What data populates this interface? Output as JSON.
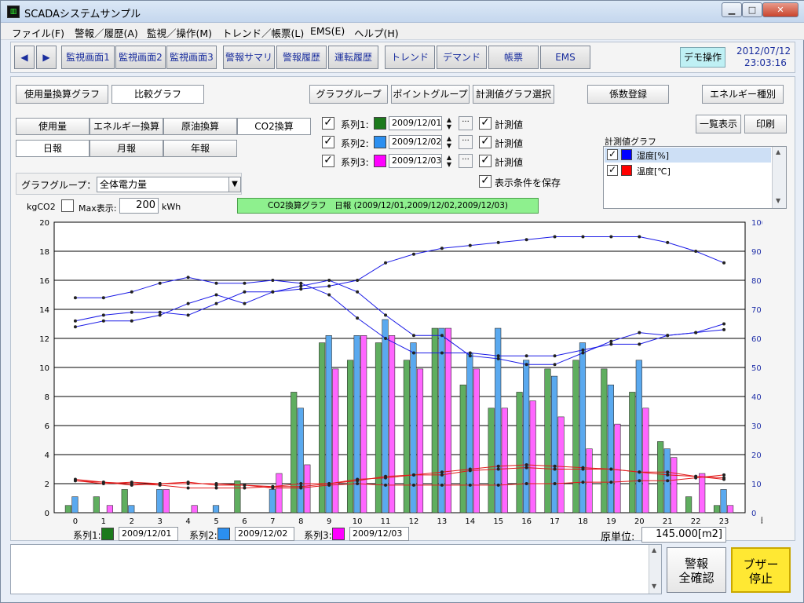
{
  "window": {
    "title": "SCADAシステムサンプル",
    "icon_name": "scada-app-icon",
    "controls": [
      "minimize-icon",
      "maximize-icon",
      "close-icon"
    ]
  },
  "menu": [
    "ファイル(F)",
    "警報／履歴(A)",
    "監視／操作(M)",
    "トレンド／帳票(L)",
    "EMS(E)",
    "ヘルプ(H)"
  ],
  "toolbar": {
    "prev_icon": "◀",
    "next_icon": "▶",
    "buttons": [
      "監視画面1",
      "監視画面2",
      "監視画面3",
      "警報サマリ",
      "警報履歴",
      "運転履歴",
      "トレンド",
      "デマンド",
      "帳票",
      "EMS"
    ],
    "demo": "デモ操作",
    "date": "2012/07/12",
    "time": "23:03:16"
  },
  "tabs_top": {
    "a": "使用量換算グラフ",
    "b": "比較グラフ"
  },
  "actions": {
    "graph_group": "グラフグループ",
    "point_group": "ポイントグループ",
    "meas_select": "計測値グラフ選択",
    "coef": "係数登録",
    "energy": "エネルギー種別"
  },
  "mode_tabs": [
    "使用量",
    "エネルギー換算",
    "原油換算",
    "CO2換算"
  ],
  "period_tabs": [
    "日報",
    "月報",
    "年報"
  ],
  "series_rows": [
    {
      "label": "系列1:",
      "color": "#1c7a1c",
      "date": "2009/12/01",
      "meas": "計測値"
    },
    {
      "label": "系列2:",
      "color": "#2b8ff0",
      "date": "2009/12/02",
      "meas": "計測値"
    },
    {
      "label": "系列3:",
      "color": "#ff00ff",
      "date": "2009/12/03",
      "meas": "計測値"
    }
  ],
  "save_cond": "表示条件を保存",
  "list_btn": "一覧表示",
  "print_btn": "印刷",
  "meas_graph": {
    "title": "計測値グラフ",
    "items": [
      {
        "label": "湿度[%]",
        "color": "#0000ff"
      },
      {
        "label": "温度[℃]",
        "color": "#ff0000"
      }
    ]
  },
  "graph_group": {
    "label": "グラフグループ：",
    "value": "全体電力量"
  },
  "unit_left": "kgCO2",
  "max_label": "Max表示:",
  "max_value": "200",
  "max_unit": "kWh",
  "chart_title": "CO2換算グラフ　日報 (2009/12/01,2009/12/02,2009/12/03)",
  "legend_bottom": [
    {
      "label": "系列1:",
      "date": "2009/12/01"
    },
    {
      "label": "系列2:",
      "date": "2009/12/02"
    },
    {
      "label": "系列3:",
      "date": "2009/12/03"
    }
  ],
  "unit_price": {
    "label": "原単位:",
    "value": "145.000[m2]"
  },
  "bottom_btns": {
    "ack": "警報\n全確認",
    "buzzer": "ブザー\n停止"
  },
  "chart_data": {
    "type": "bar",
    "x": [
      0,
      1,
      2,
      3,
      4,
      5,
      6,
      7,
      8,
      9,
      10,
      11,
      12,
      13,
      14,
      15,
      16,
      17,
      18,
      19,
      20,
      21,
      22,
      23
    ],
    "xlabel": "時",
    "ylim": [
      0,
      20
    ],
    "y2lim": [
      0,
      100
    ],
    "yticks": [
      0,
      2,
      4,
      6,
      8,
      10,
      12,
      14,
      16,
      18,
      20
    ],
    "y2ticks": [
      0,
      10,
      20,
      30,
      40,
      50,
      60,
      70,
      80,
      90,
      100
    ],
    "series": [
      {
        "name": "2009/12/01",
        "color": "#5fae5f",
        "values": [
          0.5,
          1.1,
          1.6,
          0,
          0,
          0,
          2.2,
          0,
          8.3,
          11.7,
          10.5,
          11.7,
          10.5,
          12.7,
          8.8,
          7.2,
          8.3,
          9.9,
          10.5,
          9.9,
          8.3,
          4.9,
          1.1,
          0.5
        ]
      },
      {
        "name": "2009/12/02",
        "color": "#5aa9ef",
        "values": [
          1.1,
          0,
          0.5,
          1.6,
          0,
          0.5,
          0,
          1.6,
          7.2,
          12.2,
          12.2,
          13.3,
          11.7,
          12.7,
          11.0,
          12.7,
          10.5,
          9.4,
          11.7,
          8.8,
          10.5,
          4.4,
          0,
          1.6
        ]
      },
      {
        "name": "2009/12/03",
        "color": "#ff66ff",
        "values": [
          0,
          0.5,
          0,
          1.6,
          0.5,
          0,
          0,
          2.7,
          3.3,
          9.9,
          12.2,
          12.2,
          9.9,
          12.7,
          9.9,
          7.2,
          7.7,
          6.6,
          4.4,
          6.1,
          7.2,
          3.8,
          2.7,
          0.5
        ]
      }
    ],
    "humidity_lines": [
      [
        74,
        74,
        76,
        79,
        81,
        79,
        79,
        80,
        79,
        75,
        67,
        60,
        55,
        55,
        55,
        54,
        54,
        54,
        56,
        58,
        58,
        61,
        62,
        63
      ],
      [
        66,
        68,
        69,
        69,
        68,
        72,
        76,
        76,
        77,
        78,
        80,
        86,
        89,
        91,
        92,
        93,
        94,
        95,
        95,
        95,
        95,
        93,
        90,
        86
      ],
      [
        64,
        66,
        66,
        68,
        72,
        75,
        72,
        76,
        78,
        80,
        76,
        68,
        61,
        61,
        54,
        53,
        51,
        51,
        55,
        59,
        62,
        61,
        62,
        65
      ]
    ],
    "temperature_lines": [
      [
        11.5,
        10.5,
        10,
        9.5,
        8.5,
        8.5,
        8.5,
        9,
        10,
        10,
        11.5,
        12,
        13,
        13,
        14.5,
        15,
        15.5,
        15,
        15,
        15,
        14,
        14,
        12.5,
        12
      ],
      [
        11,
        10,
        10.5,
        10,
        10.5,
        9.5,
        9.5,
        9,
        9,
        10,
        11,
        12.5,
        13,
        14,
        15,
        16,
        16.5,
        16,
        15.5,
        15,
        14,
        13,
        12.5,
        11.5
      ],
      [
        11,
        10.5,
        9.5,
        10,
        10,
        10,
        9.5,
        8.5,
        8.5,
        9.5,
        10,
        9.5,
        9.5,
        9.5,
        9.5,
        9.5,
        10,
        10,
        10.5,
        10.5,
        11,
        11,
        12,
        13
      ]
    ]
  }
}
